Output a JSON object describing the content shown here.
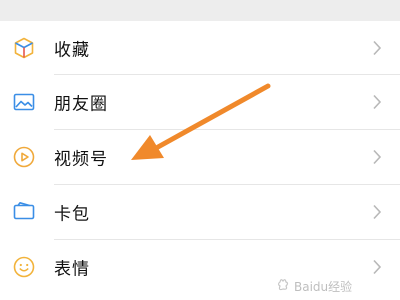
{
  "menu": {
    "items": [
      {
        "label": "收藏",
        "icon": "cube-icon"
      },
      {
        "label": "朋友圈",
        "icon": "image-icon"
      },
      {
        "label": "视频号",
        "icon": "play-circle-icon"
      },
      {
        "label": "卡包",
        "icon": "card-wallet-icon"
      },
      {
        "label": "表情",
        "icon": "smiley-icon"
      }
    ]
  },
  "annotation": {
    "color": "#f0892b"
  },
  "watermark": {
    "brand": "Baidu经验"
  }
}
